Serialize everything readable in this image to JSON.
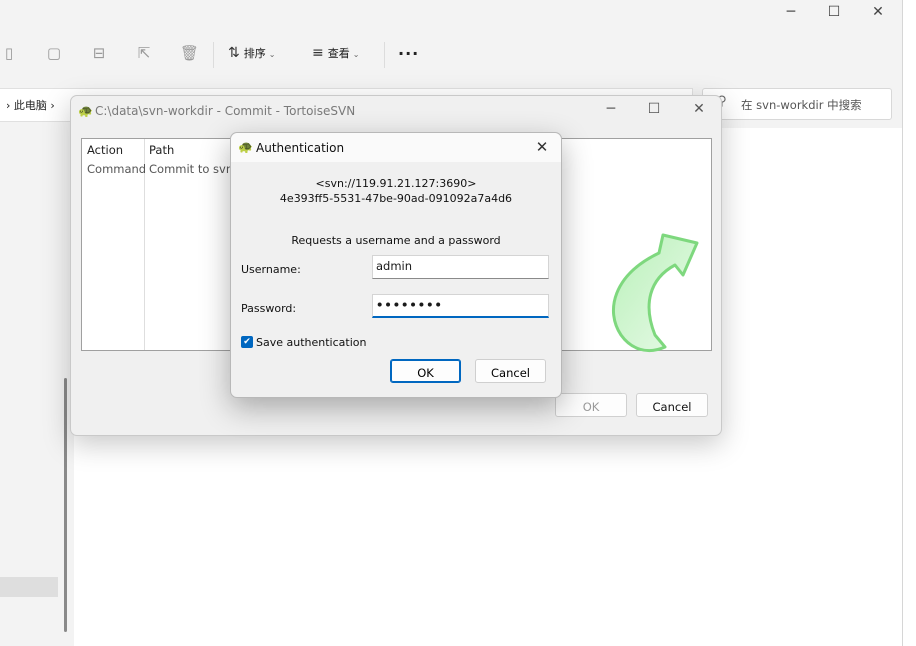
{
  "explorer": {
    "controls": {
      "minimize": "─",
      "maximize": "☐",
      "close": "✕"
    },
    "toolbar": {
      "sort_label": "排序",
      "view_label": "查看",
      "more_label": "···"
    },
    "breadcrumb": "› 此电脑 ›",
    "search_placeholder": "在 svn-workdir 中搜索"
  },
  "commit_window": {
    "title": "C:\\data\\svn-workdir - Commit - TortoiseSVN",
    "controls": {
      "minimize": "─",
      "maximize": "☐",
      "close": "✕"
    },
    "table": {
      "columns": [
        "Action",
        "Path"
      ],
      "rows": [
        {
          "action": "Command",
          "path": "Commit to svn://"
        }
      ]
    },
    "ok_label": "OK",
    "cancel_label": "Cancel"
  },
  "auth_dialog": {
    "title": "Authentication",
    "close": "✕",
    "realm_url": "<svn://119.91.21.127:3690>",
    "realm_uuid": "4e393ff5-5531-47be-90ad-091092a7a4d6",
    "prompt": "Requests a username and a password",
    "username_label": "Username:",
    "username_value": "admin",
    "password_label": "Password:",
    "password_value": "••••••••",
    "save_label": "Save authentication",
    "save_checked": true,
    "ok_label": "OK",
    "cancel_label": "Cancel"
  },
  "colors": {
    "accent": "#0067c0",
    "arrow": "#7ed87e"
  }
}
